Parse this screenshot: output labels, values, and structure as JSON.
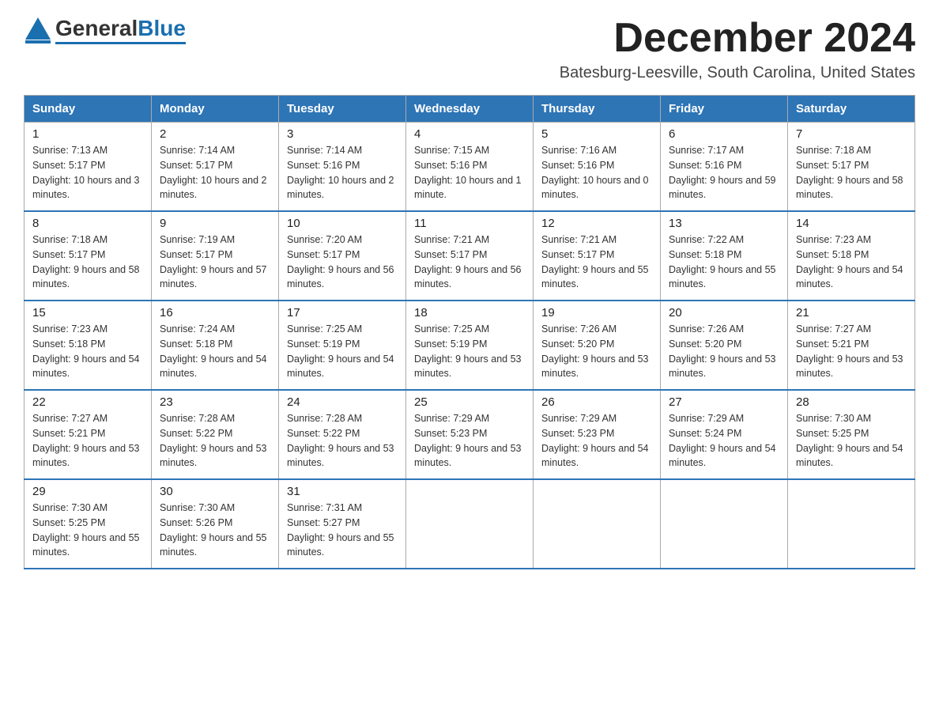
{
  "logo": {
    "general": "General",
    "blue": "Blue"
  },
  "title": "December 2024",
  "location": "Batesburg-Leesville, South Carolina, United States",
  "days_of_week": [
    "Sunday",
    "Monday",
    "Tuesday",
    "Wednesday",
    "Thursday",
    "Friday",
    "Saturday"
  ],
  "weeks": [
    [
      {
        "day": "1",
        "sunrise": "7:13 AM",
        "sunset": "5:17 PM",
        "daylight": "10 hours and 3 minutes."
      },
      {
        "day": "2",
        "sunrise": "7:14 AM",
        "sunset": "5:17 PM",
        "daylight": "10 hours and 2 minutes."
      },
      {
        "day": "3",
        "sunrise": "7:14 AM",
        "sunset": "5:16 PM",
        "daylight": "10 hours and 2 minutes."
      },
      {
        "day": "4",
        "sunrise": "7:15 AM",
        "sunset": "5:16 PM",
        "daylight": "10 hours and 1 minute."
      },
      {
        "day": "5",
        "sunrise": "7:16 AM",
        "sunset": "5:16 PM",
        "daylight": "10 hours and 0 minutes."
      },
      {
        "day": "6",
        "sunrise": "7:17 AM",
        "sunset": "5:16 PM",
        "daylight": "9 hours and 59 minutes."
      },
      {
        "day": "7",
        "sunrise": "7:18 AM",
        "sunset": "5:17 PM",
        "daylight": "9 hours and 58 minutes."
      }
    ],
    [
      {
        "day": "8",
        "sunrise": "7:18 AM",
        "sunset": "5:17 PM",
        "daylight": "9 hours and 58 minutes."
      },
      {
        "day": "9",
        "sunrise": "7:19 AM",
        "sunset": "5:17 PM",
        "daylight": "9 hours and 57 minutes."
      },
      {
        "day": "10",
        "sunrise": "7:20 AM",
        "sunset": "5:17 PM",
        "daylight": "9 hours and 56 minutes."
      },
      {
        "day": "11",
        "sunrise": "7:21 AM",
        "sunset": "5:17 PM",
        "daylight": "9 hours and 56 minutes."
      },
      {
        "day": "12",
        "sunrise": "7:21 AM",
        "sunset": "5:17 PM",
        "daylight": "9 hours and 55 minutes."
      },
      {
        "day": "13",
        "sunrise": "7:22 AM",
        "sunset": "5:18 PM",
        "daylight": "9 hours and 55 minutes."
      },
      {
        "day": "14",
        "sunrise": "7:23 AM",
        "sunset": "5:18 PM",
        "daylight": "9 hours and 54 minutes."
      }
    ],
    [
      {
        "day": "15",
        "sunrise": "7:23 AM",
        "sunset": "5:18 PM",
        "daylight": "9 hours and 54 minutes."
      },
      {
        "day": "16",
        "sunrise": "7:24 AM",
        "sunset": "5:18 PM",
        "daylight": "9 hours and 54 minutes."
      },
      {
        "day": "17",
        "sunrise": "7:25 AM",
        "sunset": "5:19 PM",
        "daylight": "9 hours and 54 minutes."
      },
      {
        "day": "18",
        "sunrise": "7:25 AM",
        "sunset": "5:19 PM",
        "daylight": "9 hours and 53 minutes."
      },
      {
        "day": "19",
        "sunrise": "7:26 AM",
        "sunset": "5:20 PM",
        "daylight": "9 hours and 53 minutes."
      },
      {
        "day": "20",
        "sunrise": "7:26 AM",
        "sunset": "5:20 PM",
        "daylight": "9 hours and 53 minutes."
      },
      {
        "day": "21",
        "sunrise": "7:27 AM",
        "sunset": "5:21 PM",
        "daylight": "9 hours and 53 minutes."
      }
    ],
    [
      {
        "day": "22",
        "sunrise": "7:27 AM",
        "sunset": "5:21 PM",
        "daylight": "9 hours and 53 minutes."
      },
      {
        "day": "23",
        "sunrise": "7:28 AM",
        "sunset": "5:22 PM",
        "daylight": "9 hours and 53 minutes."
      },
      {
        "day": "24",
        "sunrise": "7:28 AM",
        "sunset": "5:22 PM",
        "daylight": "9 hours and 53 minutes."
      },
      {
        "day": "25",
        "sunrise": "7:29 AM",
        "sunset": "5:23 PM",
        "daylight": "9 hours and 53 minutes."
      },
      {
        "day": "26",
        "sunrise": "7:29 AM",
        "sunset": "5:23 PM",
        "daylight": "9 hours and 54 minutes."
      },
      {
        "day": "27",
        "sunrise": "7:29 AM",
        "sunset": "5:24 PM",
        "daylight": "9 hours and 54 minutes."
      },
      {
        "day": "28",
        "sunrise": "7:30 AM",
        "sunset": "5:25 PM",
        "daylight": "9 hours and 54 minutes."
      }
    ],
    [
      {
        "day": "29",
        "sunrise": "7:30 AM",
        "sunset": "5:25 PM",
        "daylight": "9 hours and 55 minutes."
      },
      {
        "day": "30",
        "sunrise": "7:30 AM",
        "sunset": "5:26 PM",
        "daylight": "9 hours and 55 minutes."
      },
      {
        "day": "31",
        "sunrise": "7:31 AM",
        "sunset": "5:27 PM",
        "daylight": "9 hours and 55 minutes."
      },
      null,
      null,
      null,
      null
    ]
  ],
  "labels": {
    "sunrise": "Sunrise:",
    "sunset": "Sunset:",
    "daylight": "Daylight:"
  }
}
